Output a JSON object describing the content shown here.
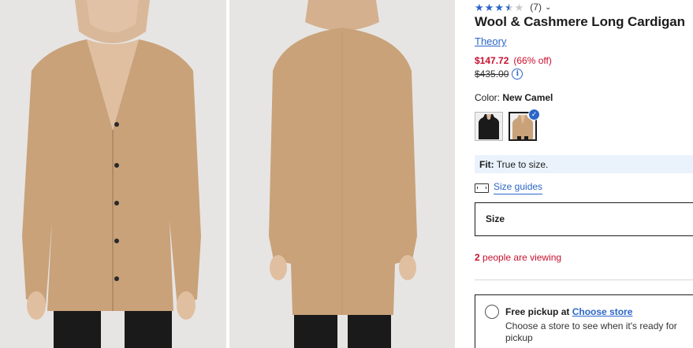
{
  "gallery": {
    "images": [
      {
        "alt": "front-view"
      },
      {
        "alt": "back-view"
      }
    ]
  },
  "product": {
    "rating": {
      "stars": 3.5,
      "max": 5,
      "count": "(7)"
    },
    "title": "Wool & Cashmere Long Cardigan",
    "brand": "Theory",
    "sale_price": "$147.72",
    "discount": "(66% off)",
    "original_price": "$435.00",
    "color_label": "Color:",
    "color_value": "New Camel",
    "swatches": [
      {
        "name": "black",
        "color": "#1a1a1a",
        "selected": false
      },
      {
        "name": "new-camel",
        "color": "#c9a27a",
        "selected": true
      }
    ],
    "fit_label": "Fit:",
    "fit_value": "True to size.",
    "size_guides": "Size guides",
    "size_label": "Size",
    "viewers_count": "2",
    "viewers_text": "people are viewing",
    "pickup": {
      "title": "Free pickup at",
      "link": "Choose store",
      "sub": "Choose a store to see when it's ready for pickup"
    }
  },
  "colors": {
    "accent": "#2b66c9",
    "sale": "#c8102e",
    "cardigan": "#c9a27a"
  }
}
